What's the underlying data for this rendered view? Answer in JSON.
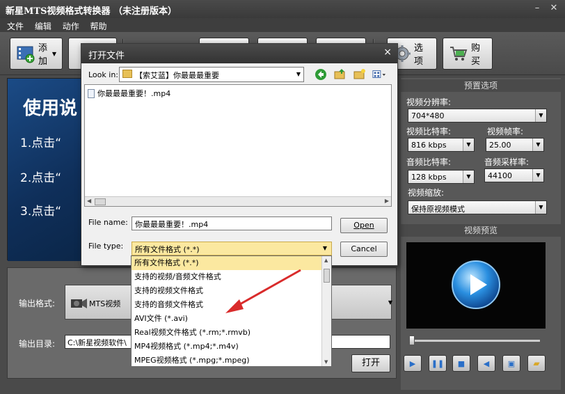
{
  "window": {
    "title": "新星MTS视频格式转换器 （未注册版本）",
    "minimize": "–",
    "close": "✕"
  },
  "menu": [
    "文件",
    "编辑",
    "动作",
    "帮助"
  ],
  "toolbar": {
    "add_label": "添加",
    "options_label": "选项",
    "buy_label": "购买"
  },
  "banner": {
    "heading": "使用说",
    "line1": "1.点击“",
    "line2": "2.点击“",
    "line3": "3.点击“"
  },
  "output": {
    "format_label": "输出格式:",
    "format_value": "MTS视频",
    "dir_label": "输出目录:",
    "dir_value": "C:\\新星视频软件\\",
    "open_button": "打开"
  },
  "presets": {
    "header": "预置选项",
    "resolution_label": "视频分辨率:",
    "resolution_value": "704*480",
    "vbitrate_label": "视频比特率:",
    "vbitrate_value": "816 kbps",
    "fps_label": "视频帧率:",
    "fps_value": "25.00",
    "abitrate_label": "音频比特率:",
    "abitrate_value": "128 kbps",
    "samplerate_label": "音频采样率:",
    "samplerate_value": "44100",
    "scale_label": "视频缩放:",
    "scale_value": "保持原视频模式",
    "preview_header": "视频预览"
  },
  "dialog": {
    "title": "打开文件",
    "close": "×",
    "look_in_label": "Look in:",
    "look_in_value": "【索艾蓝】你最最最重要",
    "file_item": "你最最最重要！.mp4",
    "file_name_label": "File name:",
    "file_name_value": "你最最最重要！.mp4",
    "file_type_label": "File type:",
    "file_type_value": "所有文件格式 (*.*)",
    "open_button": "Open",
    "cancel_button": "Cancel"
  },
  "file_type_options": [
    "所有文件格式 (*.*)",
    "支持的视频/音频文件格式",
    "支持的视频文件格式",
    "支持的音频文件格式",
    "AVI文件 (*.avi)",
    "Real视频文件格式 (*.rm;*.rmvb)",
    "MP4视频格式 (*.mp4;*.m4v)",
    "MPEG视频格式 (*.mpg;*.mpeg)"
  ],
  "colors": {
    "accent_arrow": "#d92b2b",
    "selection": "#fbe8a0",
    "window_dark": "#3e3e3e"
  }
}
